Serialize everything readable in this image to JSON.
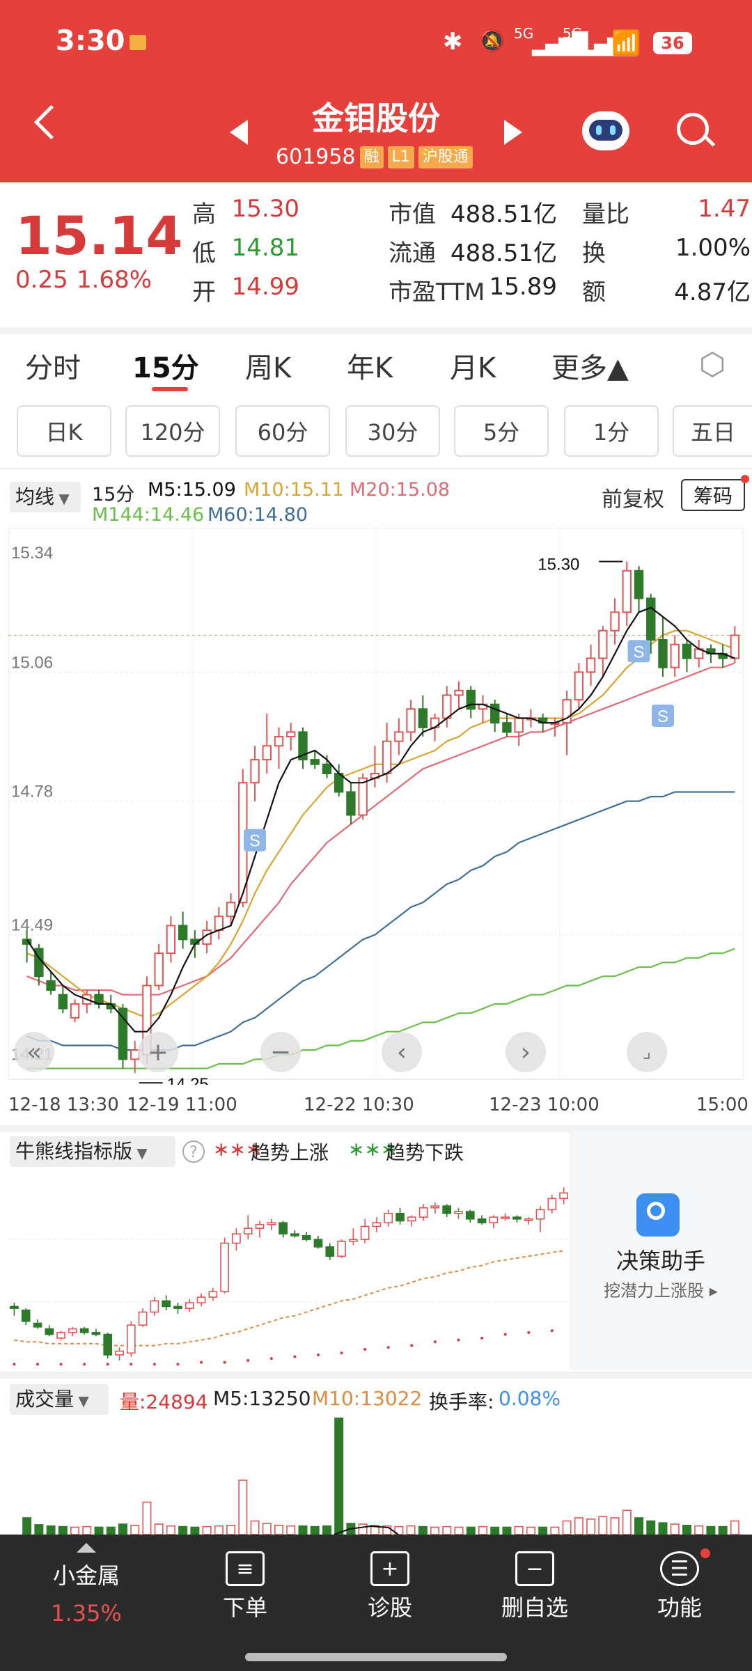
{
  "status_bar": {
    "time": "3:30",
    "battery": "36",
    "net1": "5G",
    "net2": "5G"
  },
  "header": {
    "title": "金钼股份",
    "code": "601958",
    "badges": [
      "融",
      "L1",
      "沪股通"
    ]
  },
  "quote": {
    "price": "15.14",
    "change": "0.25",
    "change_pct": "1.68%",
    "rows": [
      [
        {
          "label": "高",
          "value": "15.30",
          "tone": "red"
        },
        {
          "label": "市值",
          "value": "488.51亿",
          "tone": "dark"
        },
        {
          "label": "量比",
          "value": "1.47",
          "tone": "red"
        }
      ],
      [
        {
          "label": "低",
          "value": "14.81",
          "tone": "green"
        },
        {
          "label": "流通",
          "value": "488.51亿",
          "tone": "dark"
        },
        {
          "label": "换",
          "value": "1.00%",
          "tone": "dark"
        }
      ],
      [
        {
          "label": "开",
          "value": "14.99",
          "tone": "red"
        },
        {
          "label": "市盈TTM",
          "value": "15.89",
          "tone": "dark"
        },
        {
          "label": "额",
          "value": "4.87亿",
          "tone": "dark"
        }
      ]
    ]
  },
  "tabs": [
    "分时",
    "15分",
    "周K",
    "年K",
    "月K",
    "更多▲"
  ],
  "active_tab": "15分",
  "periods": [
    "日K",
    "120分",
    "60分",
    "30分",
    "5分",
    "1分",
    "五日"
  ],
  "ma_bar": {
    "selector": "均线",
    "period": "15分",
    "m5": "M5:15.09",
    "m10": "M10:15.11",
    "m20": "M20:15.08",
    "m144": "M144:14.46",
    "m60": "M60:14.80",
    "fq": "前复权",
    "chip": "筹码"
  },
  "chart_data": {
    "type": "candlestick",
    "y_ticks": [
      "15.34",
      "15.06",
      "14.78",
      "14.49",
      "14.21"
    ],
    "ylim": [
      14.21,
      15.34
    ],
    "x_labels": [
      "12-18 13:30",
      "12-19 11:00",
      "12-22 10:30",
      "12-23 10:00",
      "15:00"
    ],
    "high_annotation": "15.30",
    "low_annotation": "14.25",
    "ohlc": [
      [
        14.48,
        14.5,
        14.43,
        14.47
      ],
      [
        14.46,
        14.47,
        14.38,
        14.4
      ],
      [
        14.39,
        14.41,
        14.36,
        14.37
      ],
      [
        14.36,
        14.38,
        14.32,
        14.33
      ],
      [
        14.31,
        14.35,
        14.3,
        14.34
      ],
      [
        14.34,
        14.37,
        14.32,
        14.36
      ],
      [
        14.36,
        14.37,
        14.33,
        14.34
      ],
      [
        14.34,
        14.36,
        14.32,
        14.33
      ],
      [
        14.33,
        14.34,
        14.2,
        14.22
      ],
      [
        14.22,
        14.26,
        14.19,
        14.24
      ],
      [
        14.23,
        14.4,
        14.21,
        14.38
      ],
      [
        14.38,
        14.47,
        14.37,
        14.45
      ],
      [
        14.45,
        14.53,
        14.43,
        14.51
      ],
      [
        14.51,
        14.54,
        14.46,
        14.48
      ],
      [
        14.48,
        14.5,
        14.44,
        14.47
      ],
      [
        14.47,
        14.52,
        14.45,
        14.5
      ],
      [
        14.5,
        14.55,
        14.48,
        14.53
      ],
      [
        14.53,
        14.58,
        14.51,
        14.56
      ],
      [
        14.56,
        14.85,
        14.55,
        14.82
      ],
      [
        14.82,
        14.9,
        14.78,
        14.87
      ],
      [
        14.87,
        14.97,
        14.84,
        14.9
      ],
      [
        14.9,
        14.94,
        14.85,
        14.92
      ],
      [
        14.92,
        14.95,
        14.89,
        14.93
      ],
      [
        14.93,
        14.94,
        14.85,
        14.87
      ],
      [
        14.87,
        14.89,
        14.85,
        14.86
      ],
      [
        14.86,
        14.88,
        14.83,
        14.84
      ],
      [
        14.84,
        14.86,
        14.79,
        14.8
      ],
      [
        14.8,
        14.82,
        14.73,
        14.75
      ],
      [
        14.75,
        14.84,
        14.74,
        14.83
      ],
      [
        14.83,
        14.9,
        14.81,
        14.84
      ],
      [
        14.84,
        14.95,
        14.82,
        14.91
      ],
      [
        14.91,
        14.96,
        14.88,
        14.93
      ],
      [
        14.93,
        15.0,
        14.91,
        14.98
      ],
      [
        14.98,
        15.01,
        14.92,
        14.94
      ],
      [
        14.94,
        14.97,
        14.91,
        14.96
      ],
      [
        14.96,
        15.03,
        14.94,
        15.01
      ],
      [
        15.01,
        15.04,
        14.98,
        15.02
      ],
      [
        15.02,
        15.03,
        14.96,
        14.98
      ],
      [
        14.98,
        15.01,
        14.95,
        14.99
      ],
      [
        14.99,
        15.0,
        14.93,
        14.95
      ],
      [
        14.95,
        14.97,
        14.92,
        14.93
      ],
      [
        14.93,
        14.97,
        14.9,
        14.96
      ],
      [
        14.96,
        14.98,
        14.94,
        14.96
      ],
      [
        14.96,
        14.97,
        14.93,
        14.95
      ],
      [
        14.95,
        14.96,
        14.92,
        14.95
      ],
      [
        14.95,
        15.02,
        14.88,
        15.0
      ],
      [
        15.0,
        15.08,
        14.98,
        15.06
      ],
      [
        15.06,
        15.12,
        15.03,
        15.09
      ],
      [
        15.09,
        15.16,
        15.05,
        15.15
      ],
      [
        15.15,
        15.22,
        15.12,
        15.19
      ],
      [
        15.19,
        15.3,
        15.16,
        15.28
      ],
      [
        15.28,
        15.29,
        15.19,
        15.22
      ],
      [
        15.22,
        15.23,
        15.1,
        15.13
      ],
      [
        15.13,
        15.18,
        15.05,
        15.07
      ],
      [
        15.07,
        15.14,
        15.05,
        15.12
      ],
      [
        15.12,
        15.13,
        15.06,
        15.09
      ],
      [
        15.09,
        15.13,
        15.07,
        15.11
      ],
      [
        15.11,
        15.12,
        15.08,
        15.1
      ],
      [
        15.1,
        15.12,
        15.07,
        15.09
      ],
      [
        15.09,
        15.16,
        15.08,
        15.14
      ]
    ],
    "ma5": [
      14.48,
      14.44,
      14.41,
      14.38,
      14.36,
      14.35,
      14.34,
      14.34,
      14.31,
      14.28,
      14.28,
      14.31,
      14.36,
      14.42,
      14.47,
      14.49,
      14.5,
      14.51,
      14.58,
      14.66,
      14.74,
      14.82,
      14.87,
      14.88,
      14.89,
      14.87,
      14.84,
      14.82,
      14.82,
      14.83,
      14.84,
      14.86,
      14.9,
      14.93,
      14.94,
      14.96,
      14.98,
      14.99,
      14.99,
      14.98,
      14.97,
      14.96,
      14.96,
      14.95,
      14.95,
      14.96,
      14.98,
      15.01,
      15.05,
      15.1,
      15.15,
      15.19,
      15.2,
      15.18,
      15.16,
      15.13,
      15.11,
      15.1,
      15.1,
      15.09
    ],
    "ma10": [
      14.45,
      14.44,
      14.42,
      14.4,
      14.38,
      14.36,
      14.35,
      14.34,
      14.33,
      14.32,
      14.31,
      14.32,
      14.34,
      14.36,
      14.38,
      14.4,
      14.43,
      14.47,
      14.52,
      14.58,
      14.63,
      14.67,
      14.71,
      14.75,
      14.78,
      14.81,
      14.83,
      14.84,
      14.85,
      14.86,
      14.86,
      14.86,
      14.87,
      14.88,
      14.89,
      14.91,
      14.92,
      14.94,
      14.95,
      14.96,
      14.96,
      14.96,
      14.96,
      14.96,
      14.96,
      14.96,
      14.97,
      14.99,
      15.01,
      15.04,
      15.07,
      15.09,
      15.12,
      15.14,
      15.15,
      15.15,
      15.14,
      15.13,
      15.12,
      15.11
    ],
    "ma20": [
      14.4,
      14.39,
      14.38,
      14.38,
      14.37,
      14.37,
      14.37,
      14.37,
      14.36,
      14.36,
      14.36,
      14.36,
      14.37,
      14.38,
      14.39,
      14.4,
      14.42,
      14.44,
      14.47,
      14.5,
      14.53,
      14.56,
      14.6,
      14.63,
      14.66,
      14.69,
      14.71,
      14.73,
      14.75,
      14.77,
      14.79,
      14.81,
      14.83,
      14.85,
      14.86,
      14.87,
      14.88,
      14.89,
      14.9,
      14.91,
      14.92,
      14.92,
      14.93,
      14.93,
      14.94,
      14.95,
      14.96,
      14.97,
      14.98,
      14.99,
      15.0,
      15.01,
      15.02,
      15.03,
      15.04,
      15.05,
      15.06,
      15.07,
      15.07,
      15.08
    ],
    "ma60": [
      14.27,
      14.26,
      14.26,
      14.25,
      14.25,
      14.25,
      14.25,
      14.25,
      14.24,
      14.24,
      14.24,
      14.24,
      14.24,
      14.25,
      14.25,
      14.26,
      14.27,
      14.28,
      14.3,
      14.31,
      14.33,
      14.35,
      14.37,
      14.39,
      14.4,
      14.42,
      14.44,
      14.46,
      14.48,
      14.49,
      14.51,
      14.53,
      14.55,
      14.56,
      14.58,
      14.6,
      14.61,
      14.63,
      14.64,
      14.66,
      14.67,
      14.69,
      14.7,
      14.71,
      14.72,
      14.73,
      14.74,
      14.75,
      14.76,
      14.77,
      14.78,
      14.78,
      14.79,
      14.79,
      14.8,
      14.8,
      14.8,
      14.8,
      14.8,
      14.8
    ],
    "ma144": [
      14.2,
      14.2,
      14.2,
      14.2,
      14.2,
      14.2,
      14.2,
      14.2,
      14.2,
      14.2,
      14.2,
      14.2,
      14.2,
      14.2,
      14.2,
      14.2,
      14.21,
      14.21,
      14.21,
      14.22,
      14.22,
      14.23,
      14.23,
      14.24,
      14.24,
      14.25,
      14.25,
      14.26,
      14.26,
      14.27,
      14.28,
      14.28,
      14.29,
      14.3,
      14.3,
      14.31,
      14.32,
      14.32,
      14.33,
      14.34,
      14.34,
      14.35,
      14.36,
      14.36,
      14.37,
      14.38,
      14.38,
      14.39,
      14.4,
      14.4,
      14.41,
      14.42,
      14.42,
      14.43,
      14.43,
      14.44,
      14.44,
      14.45,
      14.45,
      14.46
    ],
    "sell_markers": [
      {
        "index": 19,
        "label": "S"
      },
      {
        "index": 51,
        "label": "S"
      },
      {
        "index": 53,
        "label": "S"
      }
    ]
  },
  "bull_bear": {
    "title": "牛熊线指标版",
    "up": "趋势上涨",
    "down": "趋势下跌"
  },
  "assistant": {
    "title": "决策助手",
    "subtitle": "挖潜力上涨股 ▸"
  },
  "volume": {
    "title": "成交量",
    "vol": "量:24894",
    "m5": "M5:13250",
    "m10": "M10:13022",
    "turnover_label": "换手率:",
    "turnover": "0.08%"
  },
  "bottom_nav": {
    "sector": "小金属",
    "sector_pct": "1.35%",
    "items": [
      {
        "label": "下单",
        "icon": "≡"
      },
      {
        "label": "诊股",
        "icon": "+"
      },
      {
        "label": "删自选",
        "icon": "−"
      },
      {
        "label": "功能",
        "icon": "☰"
      }
    ]
  },
  "colors": {
    "header": "#e5403c",
    "up": "#e55353",
    "down": "#2c7a2a",
    "ma5": "#111111",
    "ma10": "#d9a530",
    "ma20": "#e06a75",
    "ma60": "#3e6f99",
    "ma144": "#6bbf4c"
  }
}
